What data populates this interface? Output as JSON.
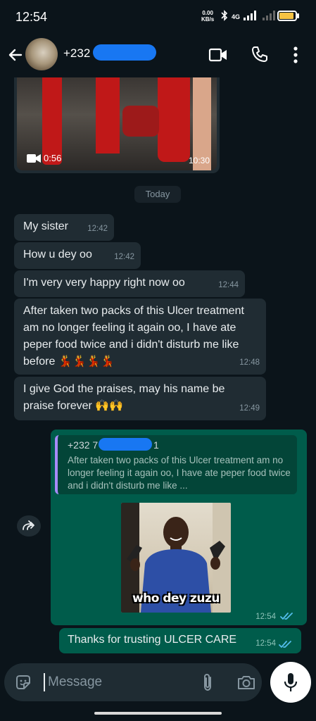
{
  "status_bar": {
    "time": "12:54",
    "speed_value": "0.00",
    "speed_unit": "KB/s",
    "network": "4G",
    "battery_percent": 90
  },
  "header": {
    "contact_prefix": "+232 7",
    "icons": [
      "back-arrow-icon",
      "video-call-icon",
      "phone-icon",
      "more-vert-icon"
    ]
  },
  "video_message": {
    "duration": "0:56",
    "time": "10:30"
  },
  "date_separator": "Today",
  "incoming_messages": [
    {
      "text": "My sister",
      "time": "12:42"
    },
    {
      "text": "How u dey oo",
      "time": "12:42"
    },
    {
      "text": "I'm very very happy right now oo",
      "time": "12:44"
    },
    {
      "text": "After taken two packs of this Ulcer treatment am no longer feeling it again oo, I have ate peper food twice and i didn't disturb me like before 💃💃💃💃",
      "time": "12:48"
    },
    {
      "text": "I give God the praises, may his name be praise forever 🙌🙌",
      "time": "12:49"
    }
  ],
  "reply_message": {
    "quoted_name": "+232 7",
    "quoted_name_suffix": "1",
    "quoted_text": "After taken two packs of this Ulcer treatment am no longer feeling it again oo, I have ate peper food twice and i didn't disturb me like ...",
    "image_caption": "who dey zuzu",
    "time": "12:54",
    "status": "read"
  },
  "outgoing_message": {
    "text": "Thanks for trusting ULCER CARE",
    "time": "12:54",
    "status": "read"
  },
  "input_bar": {
    "placeholder": "Message"
  },
  "colors": {
    "background": "#0b141a",
    "incoming_bubble": "#202c33",
    "outgoing_bubble": "#005c4b",
    "read_ticks": "#53bdeb",
    "redaction": "#1877f2"
  }
}
